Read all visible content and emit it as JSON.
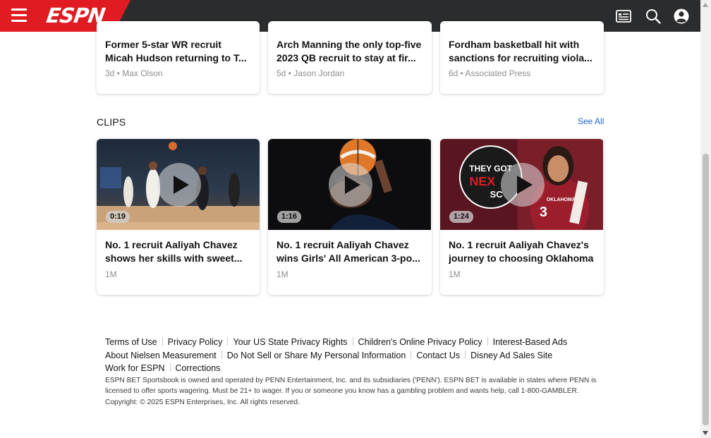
{
  "header": {
    "logo": "ESPN",
    "icons": [
      "hamburger-menu-icon",
      "news-feed-icon",
      "search-icon",
      "account-icon"
    ],
    "brand_color": "#e01c22",
    "bar_color": "#2b2c2d"
  },
  "stories": [
    {
      "title_line1": "Former 5-star WR recruit",
      "title_line2": "Micah Hudson returning to T...",
      "meta": "3d • Max Olson"
    },
    {
      "title_line1": "Arch Manning the only top-five",
      "title_line2": "2023 QB recruit to stay at fir...",
      "meta": "5d • Jason Jordan"
    },
    {
      "title_line1": "Fordham basketball hit with",
      "title_line2": "sanctions for recruiting viola...",
      "meta": "6d • Associated Press"
    }
  ],
  "clips_section": {
    "title": "CLIPS",
    "see_all": "See All",
    "clips": [
      {
        "duration": "0:19",
        "title_line1": "No. 1 recruit Aaliyah Chavez",
        "title_line2": "shows her skills with sweet...",
        "meta": "1M"
      },
      {
        "duration": "1:16",
        "title_line1": "No. 1 recruit Aaliyah Chavez",
        "title_line2": "wins Girls' All American 3-po...",
        "meta": "1M"
      },
      {
        "duration": "1:24",
        "title_line1": "No. 1 recruit Aaliyah Chavez's",
        "title_line2": "journey to choosing Oklahoma",
        "meta": "1M",
        "thumb_text_1": "THEY GOT",
        "thumb_text_2": "NEX",
        "thumb_text_3": "SC",
        "thumb_text_4": "OKLAHOMA",
        "thumb_text_5": "3"
      }
    ]
  },
  "footer": {
    "links": [
      "Terms of Use",
      "Privacy Policy",
      "Your US State Privacy Rights",
      "Children's Online Privacy Policy",
      "Interest-Based Ads",
      "About Nielsen Measurement",
      "Do Not Sell or Share My Personal Information",
      "Contact Us",
      "Disney Ad Sales Site",
      "Work for ESPN",
      "Corrections"
    ],
    "legal": "ESPN BET Sportsbook is owned and operated by PENN Entertainment, Inc. and its subsidiaries ('PENN'). ESPN BET is available in states where PENN is licensed to offer sports wagering. Must be 21+ to wager. If you or someone you know has a gambling problem and wants help, call 1-800-GAMBLER.",
    "copyright": "Copyright: © 2025 ESPN Enterprises, Inc. All rights reserved."
  }
}
